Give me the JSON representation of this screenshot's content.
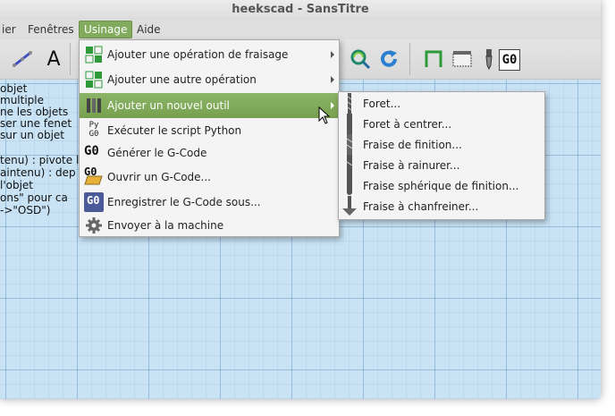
{
  "window": {
    "title": "heekscad - SansTitre"
  },
  "menubar": {
    "items": [
      "ier",
      "Fenêtres",
      "Usinage",
      "Aide"
    ],
    "active": "Usinage"
  },
  "toolbar": {
    "text_tool": "A",
    "g0": "G0",
    "icons": [
      "line-tool-icon",
      "text-tool-icon",
      "zoom-magnifier-icon",
      "refresh-icon",
      "pocket-profile-icon",
      "stock-icon",
      "drill-icon",
      "g0-icon"
    ]
  },
  "help_text": [
    "objet",
    "multiple",
    "ne les objets",
    "ser une fenet",
    "sur un objet",
    "",
    "tenu) : pivote l",
    "aintenu) : dep",
    "l'objet",
    "ons\" pour ca",
    "->\"OSD\")"
  ],
  "usinage_menu": {
    "items": [
      {
        "label": "Ajouter une opération de fraisage",
        "icon": "milling-operation-icon",
        "submenu": true
      },
      {
        "label": "Ajouter une autre opération",
        "icon": "other-operation-icon",
        "submenu": true
      },
      {
        "label": "Ajouter un nouvel outil",
        "icon": "new-tool-icon",
        "submenu": true,
        "highlighted": true
      },
      {
        "label": "Exécuter le script Python",
        "icon": "python-script-icon",
        "icon_text": [
          "Py",
          "G0"
        ]
      },
      {
        "label": "Générer le G-Code",
        "icon": "generate-gcode-icon",
        "icon_text": "G0"
      },
      {
        "label": "Ouvrir un G-Code...",
        "icon": "open-gcode-icon",
        "icon_text": "G0"
      },
      {
        "label": "Enregistrer le G-Code sous...",
        "icon": "save-gcode-icon",
        "icon_text": "G0"
      },
      {
        "label": "Envoyer à la machine",
        "icon": "gear-icon"
      }
    ]
  },
  "tool_submenu": {
    "items": [
      {
        "label": "Foret...",
        "icon": "drill-bit-icon"
      },
      {
        "label": "Foret à centrer...",
        "icon": "centre-drill-icon"
      },
      {
        "label": "Fraise de finition...",
        "icon": "end-mill-icon"
      },
      {
        "label": "Fraise à rainurer...",
        "icon": "slot-cutter-icon"
      },
      {
        "label": "Fraise sphérique de finition...",
        "icon": "ball-end-mill-icon"
      },
      {
        "label": "Fraise à chanfreiner...",
        "icon": "chamfer-mill-icon"
      }
    ]
  },
  "colors": {
    "highlight": "#82ab5d",
    "canvas": "#c9e3f5",
    "menu_bg": "#f4f4f4"
  }
}
